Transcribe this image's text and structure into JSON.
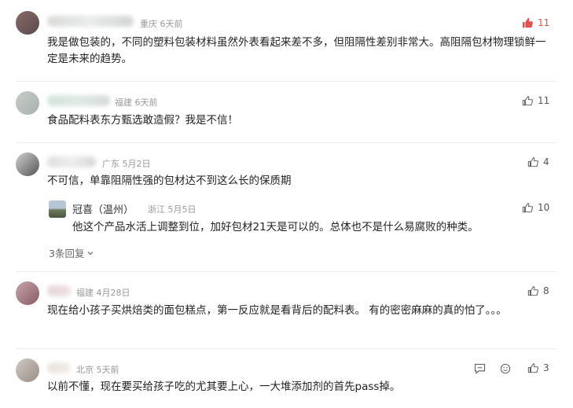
{
  "comments": [
    {
      "location": "重庆",
      "time": "6天前",
      "text": "我是做包装的，不同的塑料包装材料虽然外表看起来差不多，但阻隔性差别非常大。高阻隔包材物理锁鲜一定是未来的趋势。",
      "likes": "11",
      "liked": true
    },
    {
      "location": "福建",
      "time": "6天前",
      "text": "食品配料表东方甄选敢造假？我是不信！",
      "likes": "11",
      "liked": false
    },
    {
      "location": "广东",
      "time": "5月2日",
      "text": "不可信，单靠阻隔性强的包材达不到这么长的保质期",
      "likes": "4",
      "liked": false,
      "reply": {
        "name": "冠喜（温州）",
        "location": "浙江",
        "time": "5月5日",
        "text": "他这个产品水活上调整到位，加好包材21天是可以的。总体也不是什么易腐败的种类。",
        "likes": "10"
      },
      "more_replies": "3条回复"
    },
    {
      "location": "福建",
      "time": "4月28日",
      "text": "现在给小孩子买烘焙类的面包糕点，第一反应就是看背后的配料表。 有的密密麻麻的真的怕了。。。",
      "likes": "8",
      "liked": false
    },
    {
      "location": "北京",
      "time": "5天前",
      "text": "以前不懂，现在要买给孩子吃的尤其要上心，一大堆添加剂的首先pass掉。",
      "likes": "3",
      "liked": false
    }
  ],
  "colors": {
    "like_active": "#e25050",
    "meta": "#999999",
    "divider": "#eeeeee"
  },
  "icons": {
    "like": "thumbs-up-icon",
    "reply": "comment-bubble-icon",
    "expand": "chevron-down-icon"
  }
}
